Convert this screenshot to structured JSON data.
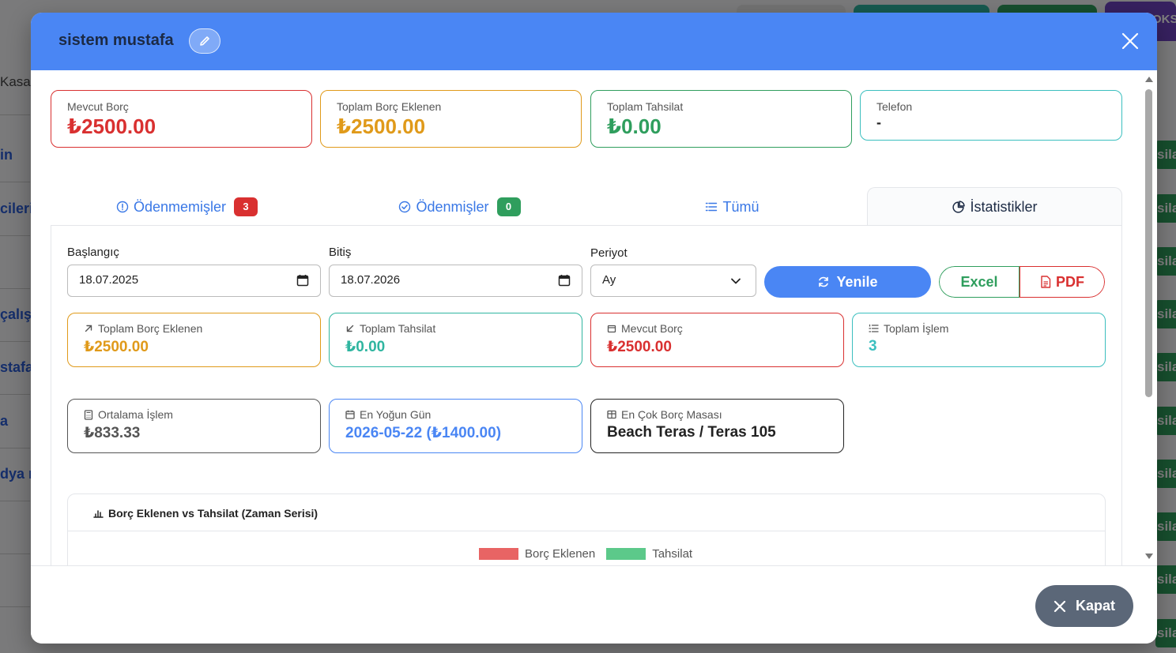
{
  "background": {
    "left_items": [
      "Kasa",
      "in",
      "cileri",
      "çalış",
      "stafa",
      "a",
      "dya r"
    ],
    "right_button_label": "sila",
    "corner_label": "OKS"
  },
  "modal": {
    "title": "sistem mustafa",
    "summary_cards": [
      {
        "label": "Mevcut Borç",
        "value": "₺2500.00",
        "color": "#d93030"
      },
      {
        "label": "Toplam Borç Eklenen",
        "value": "₺2500.00",
        "color": "#e09a1a"
      },
      {
        "label": "Toplam Tahsilat",
        "value": "₺0.00",
        "color": "#2f9e5d"
      },
      {
        "label": "Telefon",
        "value": "-",
        "color": "#3bbfbf"
      }
    ],
    "tabs": [
      {
        "label": "Ödenmemişler",
        "badge": "3",
        "badge_color": "#d93030",
        "icon": "alert-circle-icon"
      },
      {
        "label": "Ödenmişler",
        "badge": "0",
        "badge_color": "#2f9e5d",
        "icon": "check-circle-icon"
      },
      {
        "label": "Tümü",
        "icon": "list-icon"
      },
      {
        "label": "İstatistikler",
        "icon": "pie-chart-icon",
        "active": true
      }
    ],
    "filters": {
      "start_label": "Başlangıç",
      "start_value": "18.07.2025",
      "end_label": "Bitiş",
      "end_value": "18.07.2026",
      "period_label": "Periyot",
      "period_value": "Ay",
      "refresh_label": "Yenile",
      "excel_label": "Excel",
      "pdf_label": "PDF"
    },
    "stats": [
      {
        "label": "Toplam Borç Eklenen",
        "value": "₺2500.00",
        "icon": "arrow-up-right-icon",
        "color": "#e09a1a"
      },
      {
        "label": "Toplam Tahsilat",
        "value": "₺0.00",
        "icon": "arrow-down-left-icon",
        "color": "#2fb5a0"
      },
      {
        "label": "Mevcut Borç",
        "value": "₺2500.00",
        "icon": "wallet-icon",
        "color": "#d93030"
      },
      {
        "label": "Toplam İşlem",
        "value": "3",
        "icon": "list-ordered-icon",
        "color": "#3bbfbf"
      },
      {
        "label": "Ortalama İşlem",
        "value": "₺833.33",
        "icon": "calculator-icon",
        "color": "#555555"
      },
      {
        "label": "En Yoğun Gün",
        "value": "2026-05-22 (₺1400.00)",
        "icon": "calendar-icon",
        "color": "#4a86f4"
      },
      {
        "label": "En Çok Borç Masası",
        "value": "Beach Teras / Teras 105",
        "icon": "table-icon",
        "color": "#222222"
      }
    ],
    "chart": {
      "title": "Borç Eklenen vs Tahsilat (Zaman Serisi)",
      "legend": [
        {
          "name": "Borç Eklenen",
          "color": "#e86464"
        },
        {
          "name": "Tahsilat",
          "color": "#5cc98a"
        }
      ]
    },
    "close_label": "Kapat"
  }
}
